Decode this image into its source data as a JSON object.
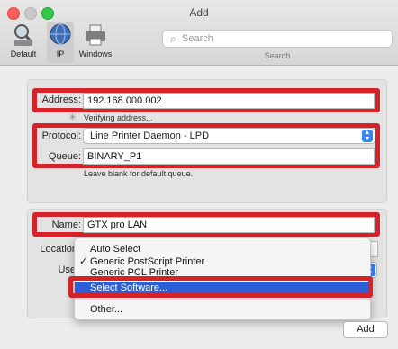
{
  "window": {
    "title": "Add"
  },
  "toolbar": {
    "default_label": "Default",
    "ip_label": "IP",
    "windows_label": "Windows",
    "search_placeholder": "Search",
    "search_label": "Search"
  },
  "ip_panel": {
    "address_label": "Address:",
    "address_value": "192.168.000.002",
    "verifying_text": "Verifying address...",
    "protocol_label": "Protocol:",
    "protocol_value": "Line Printer Daemon - LPD",
    "queue_label": "Queue:",
    "queue_value": "BINARY_P1",
    "queue_hint": "Leave blank for default queue."
  },
  "info_panel": {
    "name_label": "Name:",
    "name_value": "GTX pro LAN",
    "location_label": "Location",
    "use_label": "Use"
  },
  "menu": {
    "items": [
      "Auto Select",
      "Generic PostScript Printer",
      "Generic PCL Printer",
      "Select Software...",
      "Other..."
    ],
    "checked_index": 1,
    "active_index": 3
  },
  "footer": {
    "add_label": "Add"
  },
  "colors": {
    "highlight": "#d6232a",
    "selection": "#2c5ed7"
  }
}
